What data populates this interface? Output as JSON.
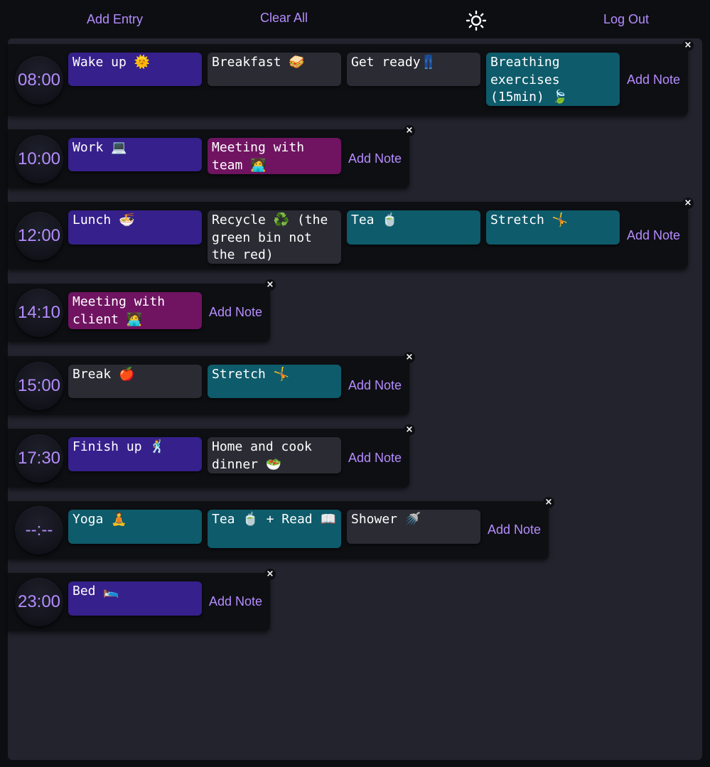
{
  "nav": {
    "add_entry": "Add Entry",
    "clear_all": "Clear All",
    "theme_icon": "sun-icon",
    "log_out": "Log Out"
  },
  "close_glyph": "×",
  "add_note_label": "Add Note",
  "colors": {
    "accent": "#b58cff",
    "purple": "#36208c",
    "gray": "#2a2b33",
    "magenta": "#701462",
    "teal": "#0e5b6b"
  },
  "rows": [
    {
      "time": "08:00",
      "entries": [
        {
          "text": "Wake up 🌞",
          "color": "purple"
        },
        {
          "text": "Breakfast 🥪",
          "color": "gray"
        },
        {
          "text": "Get ready👖",
          "color": "gray"
        },
        {
          "text": "Breathing exercises (15min) 🍃",
          "color": "teal"
        }
      ]
    },
    {
      "time": "10:00",
      "entries": [
        {
          "text": "Work 💻",
          "color": "purple"
        },
        {
          "text": "Meeting with team 🧑‍💻",
          "color": "magenta"
        }
      ]
    },
    {
      "time": "12:00",
      "entries": [
        {
          "text": "Lunch 🍜",
          "color": "purple"
        },
        {
          "text": "Recycle ♻️ (the green bin not the red)",
          "color": "gray"
        },
        {
          "text": "Tea 🍵",
          "color": "teal"
        },
        {
          "text": "Stretch 🤸",
          "color": "teal"
        }
      ]
    },
    {
      "time": "14:10",
      "entries": [
        {
          "text": "Meeting with client 🧑‍💻",
          "color": "magenta"
        }
      ]
    },
    {
      "time": "15:00",
      "entries": [
        {
          "text": "Break 🍎",
          "color": "gray"
        },
        {
          "text": "Stretch 🤸",
          "color": "teal"
        }
      ]
    },
    {
      "time": "17:30",
      "entries": [
        {
          "text": "Finish up 🕺",
          "color": "purple"
        },
        {
          "text": "Home and cook dinner 🥗",
          "color": "gray"
        }
      ]
    },
    {
      "time": "--:--",
      "entries": [
        {
          "text": "Yoga 🧘",
          "color": "teal"
        },
        {
          "text": "Tea 🍵 + Read 📖",
          "color": "teal"
        },
        {
          "text": "Shower 🚿",
          "color": "gray"
        }
      ]
    },
    {
      "time": "23:00",
      "entries": [
        {
          "text": "Bed 🛌",
          "color": "purple"
        }
      ]
    }
  ]
}
